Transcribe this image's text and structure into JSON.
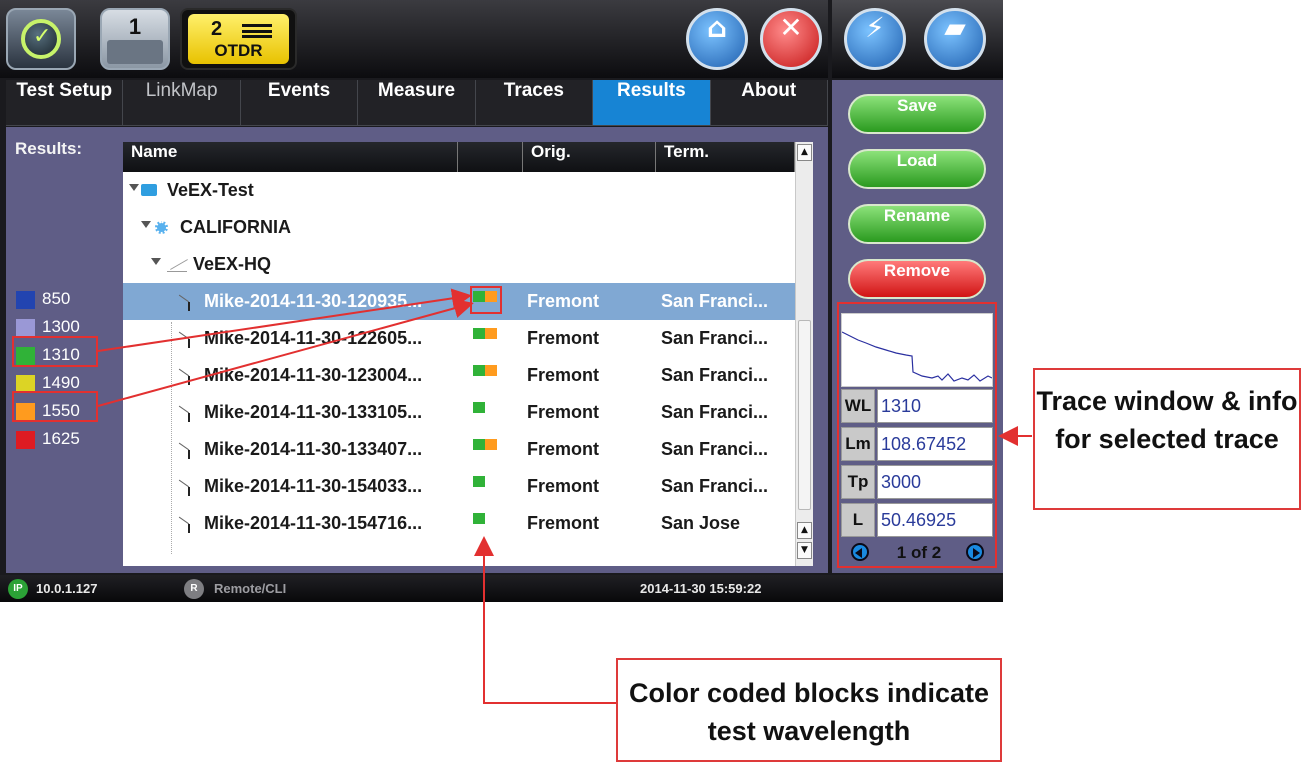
{
  "topbar": {
    "tab1_number": "1",
    "otdr_tab_number": "2",
    "otdr_tab_label": "OTDR"
  },
  "tabs": [
    {
      "label": "Test Setup",
      "state": "normal"
    },
    {
      "label": "LinkMap",
      "state": "disabled"
    },
    {
      "label": "Events",
      "state": "normal"
    },
    {
      "label": "Measure",
      "state": "normal"
    },
    {
      "label": "Traces",
      "state": "normal"
    },
    {
      "label": "Results",
      "state": "active"
    },
    {
      "label": "About",
      "state": "normal"
    }
  ],
  "results": {
    "label": "Results:",
    "legend": [
      {
        "label": "850",
        "color": "#2244b0"
      },
      {
        "label": "1300",
        "color": "#9a98d6"
      },
      {
        "label": "1310",
        "color": "#30b238"
      },
      {
        "label": "1490",
        "color": "#dcd425"
      },
      {
        "label": "1550",
        "color": "#ff9b1e"
      },
      {
        "label": "1625",
        "color": "#dd1b22"
      }
    ],
    "columns": [
      "Name",
      "",
      "Orig.",
      "Term."
    ],
    "tree": {
      "root": "VeEX-Test",
      "state": "CALIFORNIA",
      "site": "VeEX-HQ"
    },
    "rows": [
      {
        "name": "Mike-2014-11-30-120935...",
        "wavelengths": [
          "1310",
          "1550"
        ],
        "orig": "Fremont",
        "term": "San Franci...",
        "selected": true
      },
      {
        "name": "Mike-2014-11-30-122605...",
        "wavelengths": [
          "1310",
          "1550"
        ],
        "orig": "Fremont",
        "term": "San Franci...",
        "selected": false
      },
      {
        "name": "Mike-2014-11-30-123004...",
        "wavelengths": [
          "1310",
          "1550"
        ],
        "orig": "Fremont",
        "term": "San Franci...",
        "selected": false
      },
      {
        "name": "Mike-2014-11-30-133105...",
        "wavelengths": [
          "1310"
        ],
        "orig": "Fremont",
        "term": "San Franci...",
        "selected": false
      },
      {
        "name": "Mike-2014-11-30-133407...",
        "wavelengths": [
          "1310",
          "1550"
        ],
        "orig": "Fremont",
        "term": "San Franci...",
        "selected": false
      },
      {
        "name": "Mike-2014-11-30-154033...",
        "wavelengths": [
          "1310"
        ],
        "orig": "Fremont",
        "term": "San Franci...",
        "selected": false
      },
      {
        "name": "Mike-2014-11-30-154716...",
        "wavelengths": [
          "1310"
        ],
        "orig": "Fremont",
        "term": "San Jose",
        "selected": false
      }
    ]
  },
  "actions": {
    "save": "Save",
    "load": "Load",
    "rename": "Rename",
    "remove": "Remove"
  },
  "trace_info": {
    "wl_key": "WL",
    "wl_value": "1310",
    "lm_key": "Lm",
    "lm_value": "108.67452",
    "tp_key": "Tp",
    "tp_value": "3000",
    "l_key": "L",
    "l_value": "50.46925",
    "page": "1 of 2"
  },
  "status": {
    "ip_badge": "IP",
    "ip": "10.0.1.127",
    "remote_badge": "R",
    "remote": "Remote/CLI",
    "datetime": "2014-11-30  15:59:22"
  },
  "annotations": {
    "trace_callout": "Trace window & info for selected trace",
    "color_callout": "Color coded blocks indicate test wavelength",
    "accent_color": "#e23030"
  }
}
